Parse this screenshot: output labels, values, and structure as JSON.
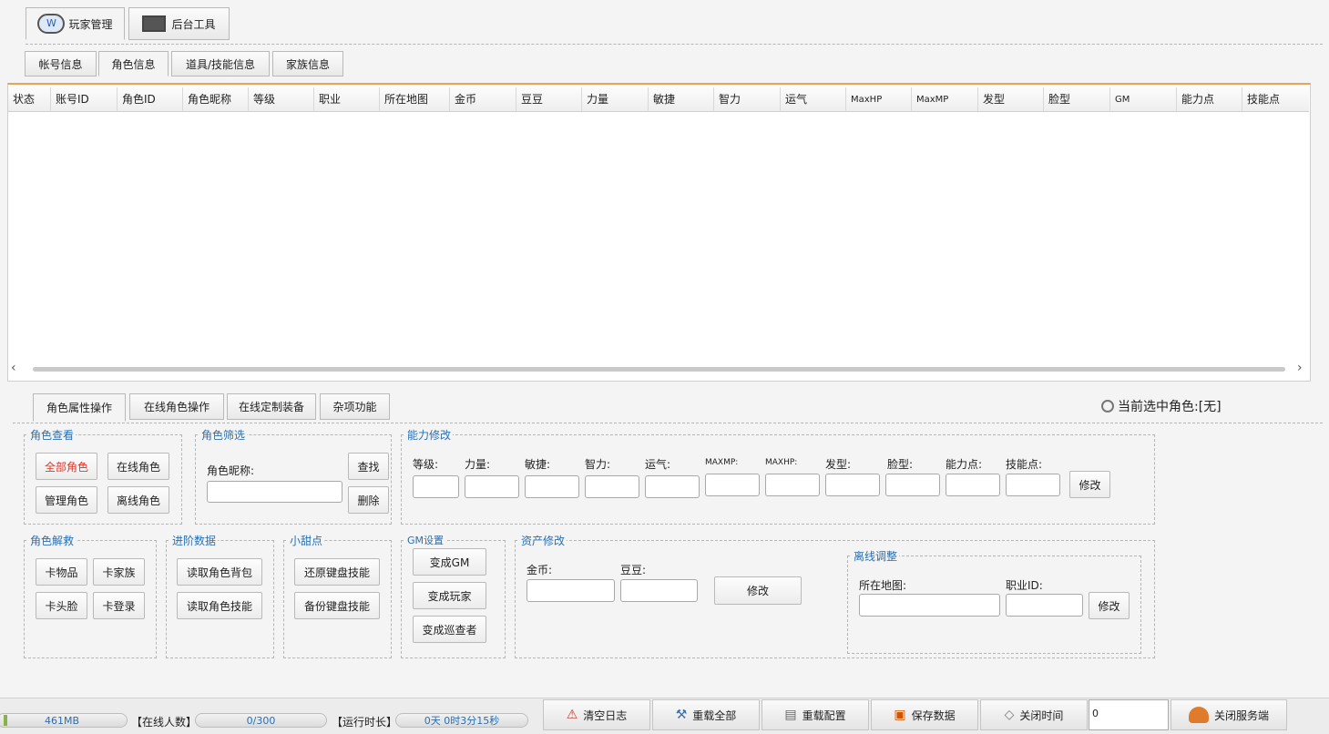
{
  "top_tabs": [
    {
      "label": "玩家管理",
      "icon": "browser-icon"
    },
    {
      "label": "后台工具",
      "icon": "laptop-icon"
    }
  ],
  "sub_tabs": [
    "帐号信息",
    "角色信息",
    "道具/技能信息",
    "家族信息"
  ],
  "table": {
    "columns": [
      "状态",
      "账号ID",
      "角色ID",
      "角色昵称",
      "等级",
      "职业",
      "所在地图",
      "金币",
      "豆豆",
      "力量",
      "敏捷",
      "智力",
      "运气",
      "MaxHP",
      "MaxMP",
      "发型",
      "脸型",
      "GM",
      "能力点",
      "技能点"
    ],
    "scroll_left": "‹",
    "scroll_right": "›"
  },
  "op_tabs": [
    "角色属性操作",
    "在线角色操作",
    "在线定制装备",
    "杂项功能"
  ],
  "current_role": "当前选中角色:[无]",
  "group_view": {
    "title": "角色查看",
    "buttons": [
      "全部角色",
      "在线角色",
      "管理角色",
      "离线角色"
    ],
    "accent": "#d9382b"
  },
  "group_filter": {
    "title": "角色筛选",
    "label": "角色昵称:",
    "find": "查找",
    "delete": "删除"
  },
  "group_ability": {
    "title": "能力修改",
    "labels": [
      "等级:",
      "力量:",
      "敏捷:",
      "智力:",
      "运气:",
      "MAXMP:",
      "MAXHP:",
      "发型:",
      "脸型:",
      "能力点:",
      "技能点:"
    ],
    "modify": "修改"
  },
  "group_rescue": {
    "title": "角色解救",
    "buttons": [
      "卡物品",
      "卡家族",
      "卡头脸",
      "卡登录"
    ]
  },
  "group_advanced": {
    "title": "进阶数据",
    "buttons": [
      "读取角色背包",
      "读取角色技能"
    ]
  },
  "group_sweet": {
    "title": "小甜点",
    "buttons": [
      "还原键盘技能",
      "备份键盘技能"
    ]
  },
  "group_gm": {
    "title": "GM设置",
    "buttons": [
      "变成GM",
      "变成玩家",
      "变成巡查者"
    ]
  },
  "group_asset": {
    "title": "资产修改",
    "gold": "金币:",
    "beans": "豆豆:",
    "modify": "修改"
  },
  "group_offline": {
    "title": "离线调整",
    "map": "所在地图:",
    "job": "职业ID:",
    "modify": "修改"
  },
  "status": {
    "memory": "461MB",
    "online_label": "【在线人数】",
    "online": "0/300",
    "runtime_label": "【运行时长】",
    "runtime": "0天 0时3分15秒",
    "buttons": [
      {
        "label": "清空日志",
        "icon": "warning-icon"
      },
      {
        "label": "重载全部",
        "icon": "hammer-icon"
      },
      {
        "label": "重载配置",
        "icon": "document-icon"
      },
      {
        "label": "保存数据",
        "icon": "box-icon"
      },
      {
        "label": "关闭时间",
        "icon": "eraser-icon"
      }
    ],
    "input_value": "0",
    "shutdown": "关闭服务端"
  }
}
